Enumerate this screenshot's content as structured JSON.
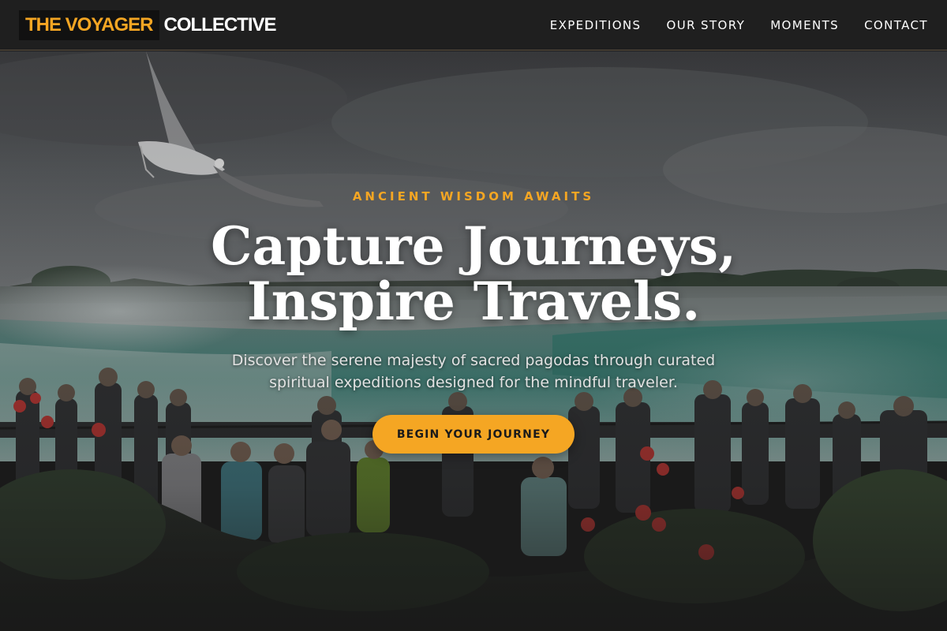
{
  "brand": {
    "highlight": "THE VOYAGER",
    "rest": "COLLECTIVE",
    "accent_color": "#f5a623"
  },
  "nav": {
    "items": [
      {
        "label": "EXPEDITIONS"
      },
      {
        "label": "OUR STORY"
      },
      {
        "label": "MOMENTS"
      },
      {
        "label": "CONTACT"
      }
    ]
  },
  "hero": {
    "eyebrow": "ANCIENT WISDOM AWAITS",
    "headline_line1": "Capture Journeys,",
    "headline_line2": "Inspire Travels.",
    "subtext": "Discover the serene majesty of sacred pagodas through curated spiritual expeditions designed for the mindful traveler.",
    "cta_label": "BEGIN YOUR JOURNEY",
    "background_subject": "waterfall-with-tourists-photo"
  }
}
